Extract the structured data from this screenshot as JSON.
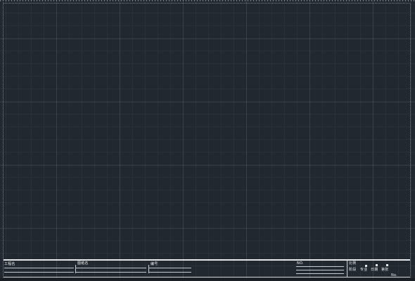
{
  "title_block": {
    "row1": {
      "project_label": "工程名",
      "drawing_label": "图纸名",
      "number_label": "编号"
    },
    "right": {
      "no_label": "NO.",
      "scale_label": "比例",
      "stage_labels": [
        "阶段",
        "专业",
        "日期",
        "第张"
      ],
      "page_label": "No."
    }
  }
}
